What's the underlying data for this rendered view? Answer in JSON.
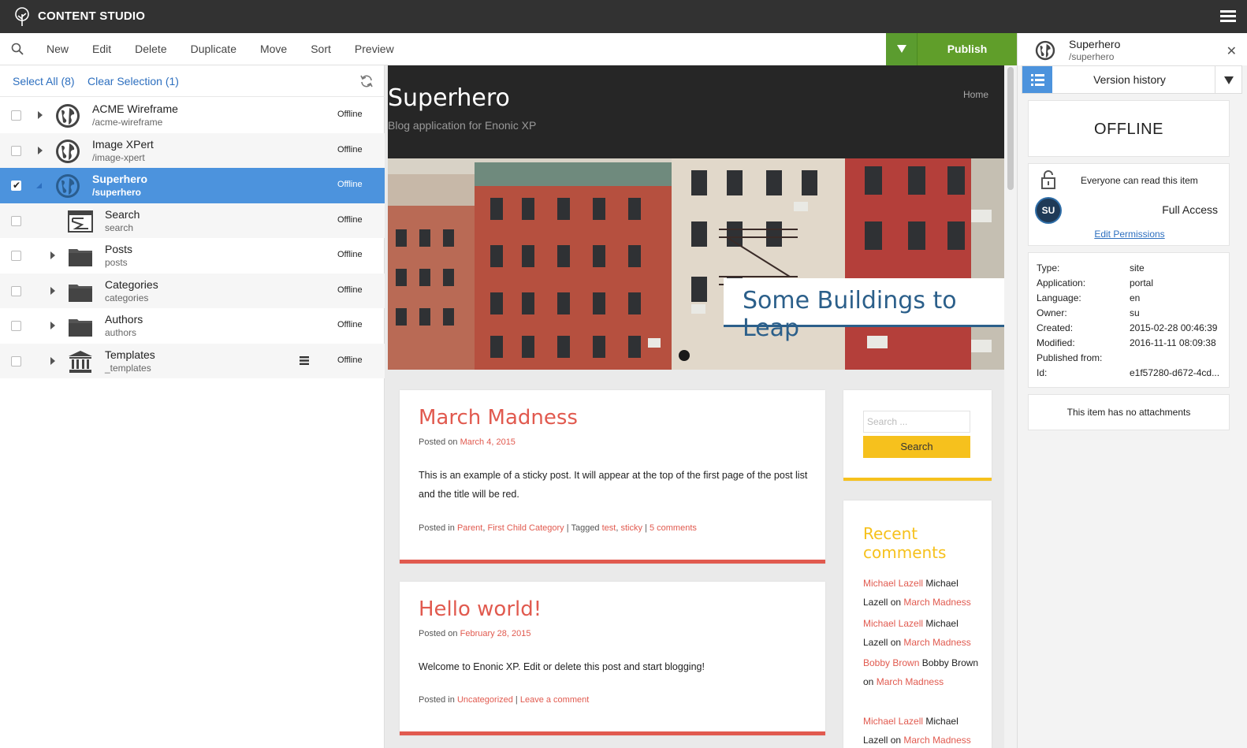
{
  "app": {
    "title": "CONTENT STUDIO",
    "logo_icon": "tree-logo-icon",
    "menu_icon": "hamburger-icon"
  },
  "toolbar": {
    "items": [
      "New",
      "Edit",
      "Delete",
      "Duplicate",
      "Move",
      "Sort",
      "Preview"
    ],
    "publish_label": "Publish",
    "publish_color": "#609e2a"
  },
  "selection": {
    "select_all": "Select All (8)",
    "clear_selection": "Clear Selection (1)"
  },
  "tree": [
    {
      "name": "ACME Wireframe",
      "path": "/acme-wireframe",
      "status": "Offline",
      "icon": "globe-icon",
      "selected": false
    },
    {
      "name": "Image XPert",
      "path": "/image-xpert",
      "status": "Offline",
      "icon": "globe-icon",
      "selected": false
    },
    {
      "name": "Superhero",
      "path": "/superhero",
      "status": "Offline",
      "icon": "globe-icon",
      "selected": true
    },
    {
      "name": "Search",
      "path": "search",
      "status": "Offline",
      "icon": "page-template-icon",
      "selected": false
    },
    {
      "name": "Posts",
      "path": "posts",
      "status": "Offline",
      "icon": "folder-icon",
      "selected": false
    },
    {
      "name": "Categories",
      "path": "categories",
      "status": "Offline",
      "icon": "folder-icon",
      "selected": false
    },
    {
      "name": "Authors",
      "path": "authors",
      "status": "Offline",
      "icon": "folder-icon",
      "selected": false
    },
    {
      "name": "Templates",
      "path": "_templates",
      "status": "Offline",
      "icon": "templates-icon",
      "selected": false
    }
  ],
  "preview": {
    "site_name": "Superhero",
    "tagline": "Blog application for Enonic XP",
    "home_link": "Home",
    "hero_caption": "Some Buildings to Leap",
    "posts": [
      {
        "title": "March Madness",
        "posted_on": "Posted on",
        "date": "March 4, 2015",
        "body": "This is an example of a sticky post. It will appear at the top of the first page of the post list and the title will be red.",
        "posted_in": "Posted in",
        "cat1": "Parent",
        "cat2": "First Child Category",
        "tagged": "| Tagged",
        "tag1": "test",
        "tag2": "sticky",
        "comments": "5 comments"
      },
      {
        "title": "Hello world!",
        "posted_on": "Posted on",
        "date": "February 28, 2015",
        "body": "Welcome to Enonic XP. Edit or delete this post and start blogging!",
        "posted_in": "Posted in",
        "cat1": "Uncategorized",
        "comments": "Leave a comment"
      }
    ],
    "search_placeholder": "Search ...",
    "search_button": "Search",
    "recent_title": "Recent comments",
    "recent_comments": [
      {
        "author": "Michael Lazell",
        "text": "Michael Lazell on",
        "post": "March Madness"
      },
      {
        "author": "Michael Lazell",
        "text": "Michael Lazell on",
        "post": "March Madness"
      },
      {
        "author": "Bobby Brown",
        "text": "Bobby Brown on",
        "post": "March Madness"
      },
      {
        "author": "Michael Lazell",
        "text": "Michael Lazell on",
        "post": "March Madness"
      }
    ],
    "accent_red": "#e15a4f",
    "accent_yellow": "#f6c11d"
  },
  "details": {
    "name": "Superhero",
    "path": "/superhero",
    "panel_selector": "Version history",
    "status": "OFFLINE",
    "permission_text": "Everyone can read this item",
    "avatar": "SU",
    "access": "Full Access",
    "edit_permissions": "Edit Permissions",
    "props": [
      {
        "label": "Type:",
        "value": "site"
      },
      {
        "label": "Application:",
        "value": "portal"
      },
      {
        "label": "Language:",
        "value": "en"
      },
      {
        "label": "Owner:",
        "value": "su"
      },
      {
        "label": "Created:",
        "value": "2015-02-28 00:46:39"
      },
      {
        "label": "Modified:",
        "value": "2016-11-11 08:09:38"
      },
      {
        "label": "Published from:",
        "value": ""
      },
      {
        "label": "Id:",
        "value": "e1f57280-d672-4cd..."
      }
    ],
    "attachments": "This item has no attachments"
  }
}
